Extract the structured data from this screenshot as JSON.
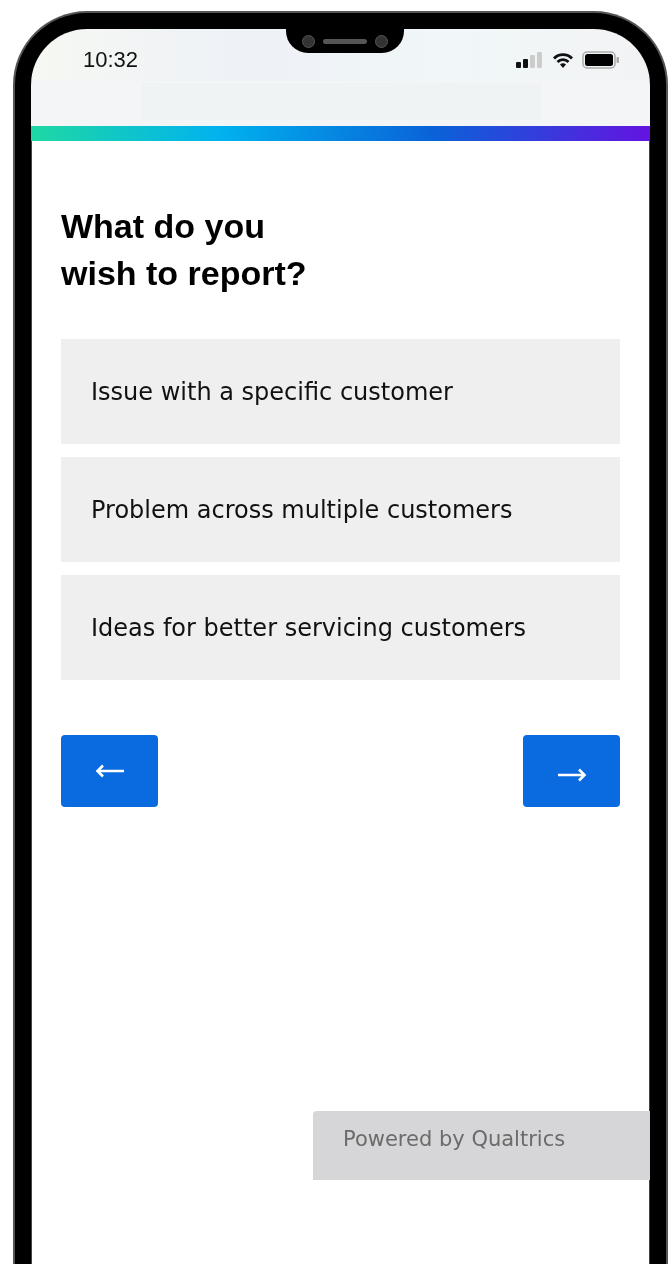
{
  "status_bar": {
    "time": "10:32"
  },
  "question": {
    "title": "What do you wish to report?"
  },
  "options": [
    {
      "label": "Issue with a specific customer",
      "selected": false
    },
    {
      "label": "Problem across multiple customers",
      "selected": false
    },
    {
      "label": "Ideas for better servicing customers",
      "selected": false
    }
  ],
  "footer": {
    "text": "Powered by Qualtrics"
  }
}
